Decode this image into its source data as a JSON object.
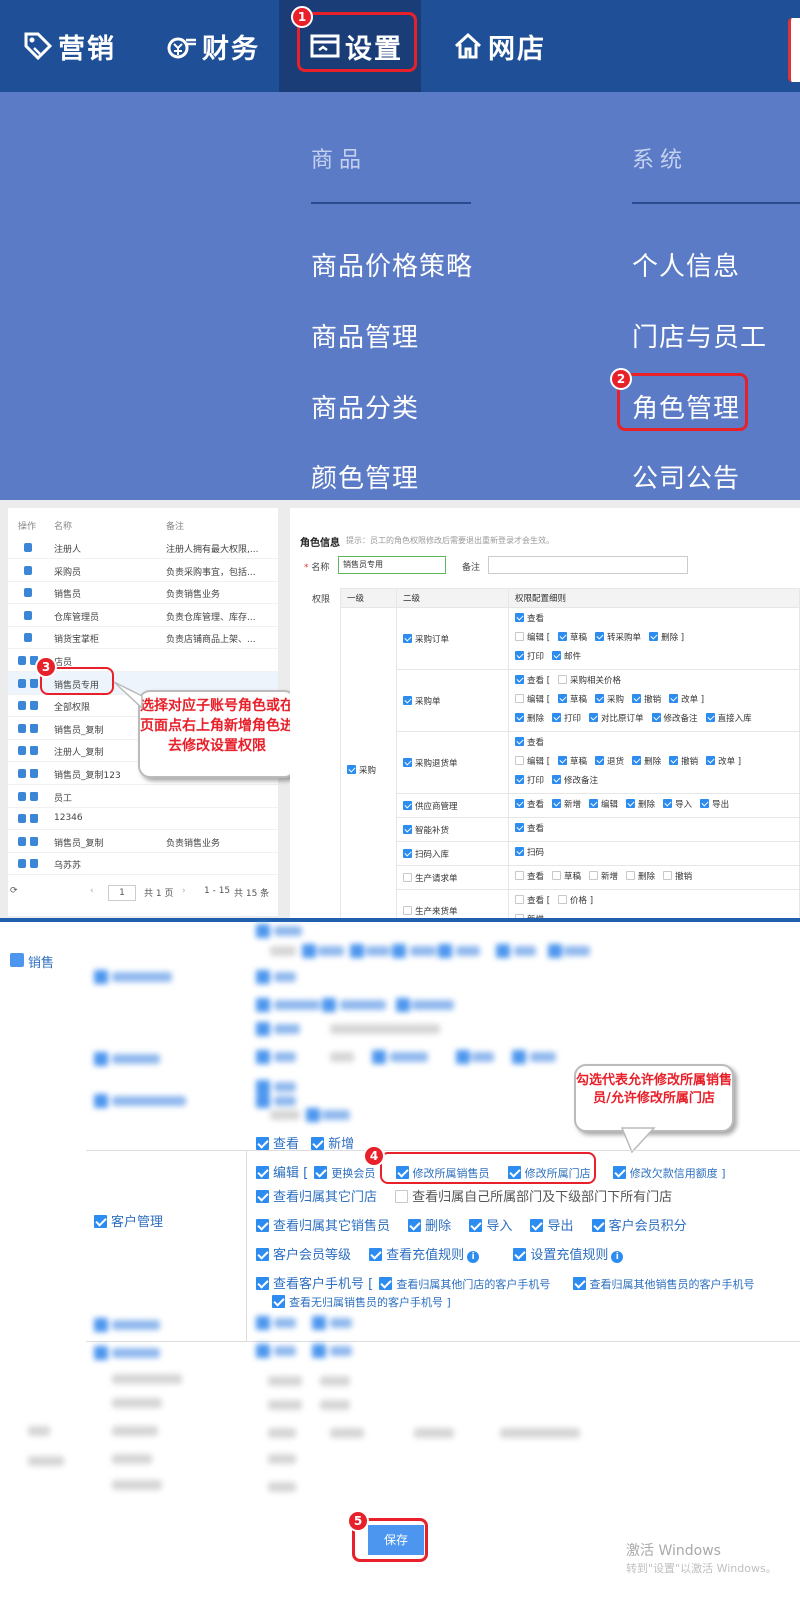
{
  "panel1": {
    "nav": [
      {
        "label": "营销",
        "icon": "tag-icon"
      },
      {
        "label": "财务",
        "icon": "money-icon"
      },
      {
        "label": "设置",
        "icon": "settings-window-icon"
      },
      {
        "label": "网店",
        "icon": "home-icon"
      }
    ],
    "columns": {
      "goods": {
        "title": "商品",
        "items": [
          "商品价格策略",
          "商品管理",
          "商品分类",
          "颜色管理"
        ]
      },
      "system": {
        "title": "系统",
        "items": [
          "个人信息",
          "门店与员工",
          "角色管理",
          "公司公告"
        ]
      }
    },
    "badges": [
      "1",
      "2"
    ]
  },
  "panel2": {
    "roles": {
      "headers": {
        "op": "操作",
        "name": "名称",
        "remark": "备注"
      },
      "rows": [
        {
          "name": "注册人",
          "remark": "注册人拥有最大权限,..."
        },
        {
          "name": "采购员",
          "remark": "负责采购事宜，包括..."
        },
        {
          "name": "销售员",
          "remark": "负责销售业务"
        },
        {
          "name": "仓库管理员",
          "remark": "负责仓库管理、库存..."
        },
        {
          "name": "销货宝掌柜",
          "remark": "负责店铺商品上架、..."
        },
        {
          "name": "店员",
          "remark": ""
        },
        {
          "name": "销售员专用",
          "remark": ""
        },
        {
          "name": "全部权限",
          "remark": ""
        },
        {
          "name": "销售员_复制",
          "remark": ""
        },
        {
          "name": "注册人_复制",
          "remark": ""
        },
        {
          "name": "销售员_复制123",
          "remark": ""
        },
        {
          "name": "员工",
          "remark": ""
        },
        {
          "name": "12346",
          "remark": ""
        },
        {
          "name": "销售员_复制",
          "remark": "负责销售业务"
        },
        {
          "name": "乌苏苏",
          "remark": ""
        }
      ],
      "pager": {
        "page": "1",
        "total_pages": "共 1 页",
        "range": "1 - 15",
        "total": "共 15 条",
        "prev": "‹",
        "next": "›",
        "refresh": "⟳"
      }
    },
    "badge": "3",
    "callout": "选择对应子账号角色或在页面点右上角新增角色进去修改设置权限",
    "detail": {
      "title": "角色信息",
      "hint": "提示：员工的角色权限修改后需要退出重新登录才会生效。",
      "name_label": "名称",
      "name_value": "销售员专用",
      "remark_label": "备注",
      "perm_label": "权限",
      "table_headers": [
        "一级",
        "二级",
        "权限配置细则"
      ],
      "level1": "采购",
      "rows": {
        "r1": {
          "name": "采购订单",
          "l1": [
            "查看"
          ],
          "l2": [
            "编辑 [",
            "草稿",
            "转采购单",
            "删除 ]"
          ],
          "l3": [
            "打印",
            "邮件"
          ]
        },
        "r2": {
          "name": "采购单",
          "l1": [
            "查看 [",
            "采购相关价格"
          ],
          "l2": [
            "编辑 [",
            "草稿",
            "采购",
            "撤销",
            "改单 ]"
          ],
          "l3": [
            "删除",
            "打印",
            "对比原订单",
            "修改备注",
            "直接入库"
          ]
        },
        "r3": {
          "name": "采购退货单",
          "l1": [
            "查看"
          ],
          "l2": [
            "编辑 [",
            "草稿",
            "退货",
            "删除",
            "撤销",
            "改单 ]"
          ],
          "l3": [
            "打印",
            "修改备注"
          ]
        },
        "r4": {
          "name": "供应商管理",
          "l1": [
            "查看",
            "新增",
            "编辑",
            "删除",
            "导入",
            "导出"
          ]
        },
        "r5": {
          "name": "智能补货",
          "l1": [
            "查看"
          ]
        },
        "r6": {
          "name": "扫码入库",
          "l1": [
            "扫码"
          ]
        },
        "r7": {
          "name": "生产请求单",
          "l1": [
            "查看",
            "草稿",
            "新增",
            "删除",
            "撤销"
          ]
        },
        "r8": {
          "name": "生产来货单",
          "l1": [
            "查看 [",
            "价格 ]"
          ],
          "l2": [
            "新增"
          ]
        }
      }
    }
  },
  "panel3": {
    "sales_label": "销售",
    "badges": [
      "4",
      "5"
    ],
    "callout": "勾选代表允许修改所属销售员/允许修改所属门店",
    "customer": {
      "label": "客户管理",
      "line1": [
        "查看",
        "新增"
      ],
      "line2": [
        "编辑 [",
        "更换会员",
        "修改所属销售员",
        "修改所属门店",
        "修改欠款信用额度 ]"
      ],
      "line3": [
        "查看归属其它门店",
        "查看归属自己所属部门及下级部门下所有门店"
      ],
      "line4": [
        "查看归属其它销售员",
        "删除",
        "导入",
        "导出",
        "客户会员积分"
      ],
      "line5": [
        "客户会员等级",
        "查看充值规则",
        "设置充值规则"
      ],
      "line6": [
        "查看客户手机号 [",
        "查看归属其他门店的客户手机号",
        "查看归属其他销售员的客户手机号"
      ],
      "line7": [
        "查看无归属销售员的客户手机号 ]"
      ]
    },
    "save_label": "保存",
    "watermark": "激活 Windows",
    "watermark_sub": "转到\"设置\"以激活 Windows。"
  }
}
